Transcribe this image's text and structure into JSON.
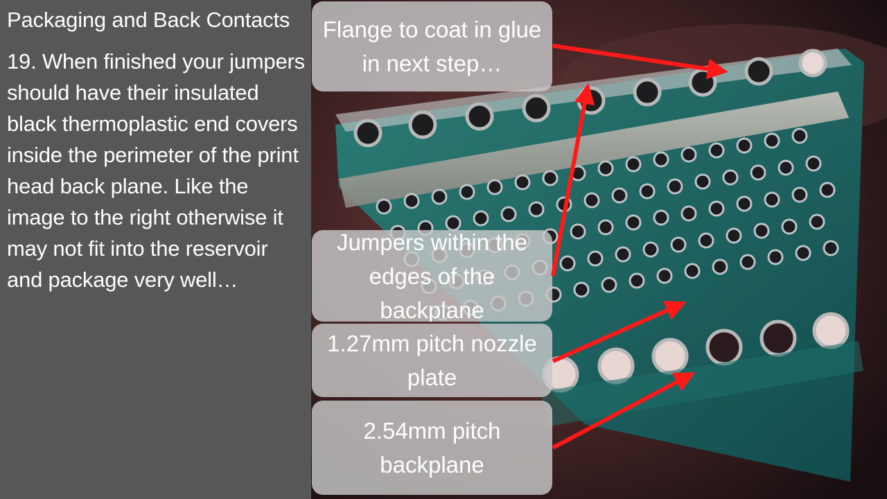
{
  "slide": {
    "title": "Packaging and Back Contacts",
    "body": "19. When finished your jumpers should have their insulated black thermoplastic end covers inside the perimeter of the print head back plane. Like the image to the right otherwise it may not fit into the reservoir and package very well…"
  },
  "callouts": {
    "flange": "Flange to coat in glue in next step…",
    "jumpers": "Jumpers within the edges of the backplane",
    "nozzle_plate": "1.27mm pitch nozzle plate",
    "backplane": "2.54mm pitch backplane"
  },
  "colors": {
    "text_panel": "#575757",
    "callout_box": "#c8c8c8",
    "arrow": "#ff1a1a",
    "pcb": "#1f6f6a",
    "pad": "#b9c1c4"
  }
}
